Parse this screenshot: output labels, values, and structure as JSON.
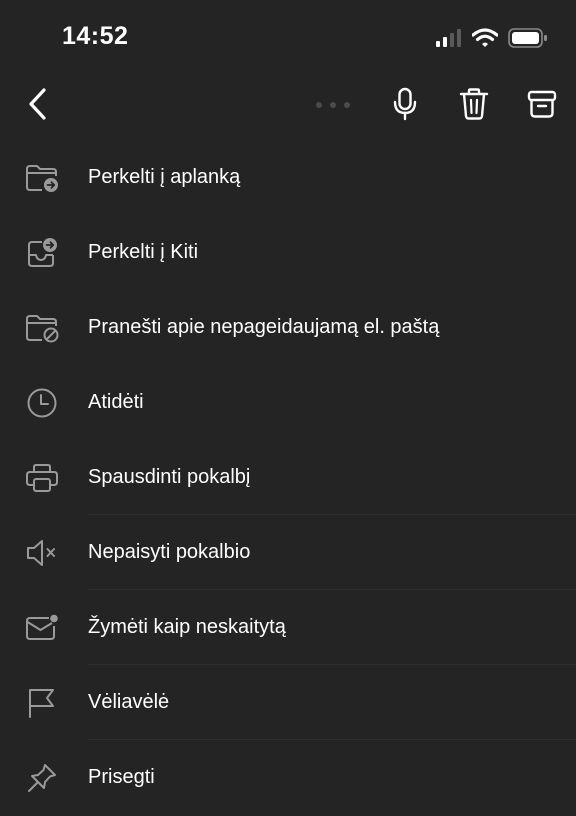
{
  "status_bar": {
    "time": "14:52",
    "icons": [
      "cellular-signal-icon",
      "wifi-icon",
      "battery-icon"
    ]
  },
  "toolbar": {
    "back_icon": "chevron-left-icon",
    "actions": [
      "microphone-icon",
      "trash-icon",
      "archive-icon"
    ]
  },
  "menu": {
    "items": [
      {
        "label": "Perkelti į aplanką",
        "icon": "folder-move-icon"
      },
      {
        "label": "Perkelti į Kiti",
        "icon": "inbox-move-icon"
      },
      {
        "label": "Pranešti apie nepageidaujamą el. paštą",
        "icon": "folder-block-icon"
      },
      {
        "label": "Atidėti",
        "icon": "clock-icon"
      },
      {
        "label": "Spausdinti pokalbį",
        "icon": "printer-icon"
      },
      {
        "label": "Nepaisyti pokalbio",
        "icon": "speaker-mute-icon"
      },
      {
        "label": "Žymėti kaip neskaitytą",
        "icon": "mail-unread-icon"
      },
      {
        "label": "Vėliavėlė",
        "icon": "flag-icon"
      },
      {
        "label": "Prisegti",
        "icon": "pin-icon"
      }
    ]
  },
  "colors": {
    "background": "#242424",
    "text": "#ffffff",
    "icon_muted": "#9a9a9a",
    "divider": "#2e2e2e"
  }
}
